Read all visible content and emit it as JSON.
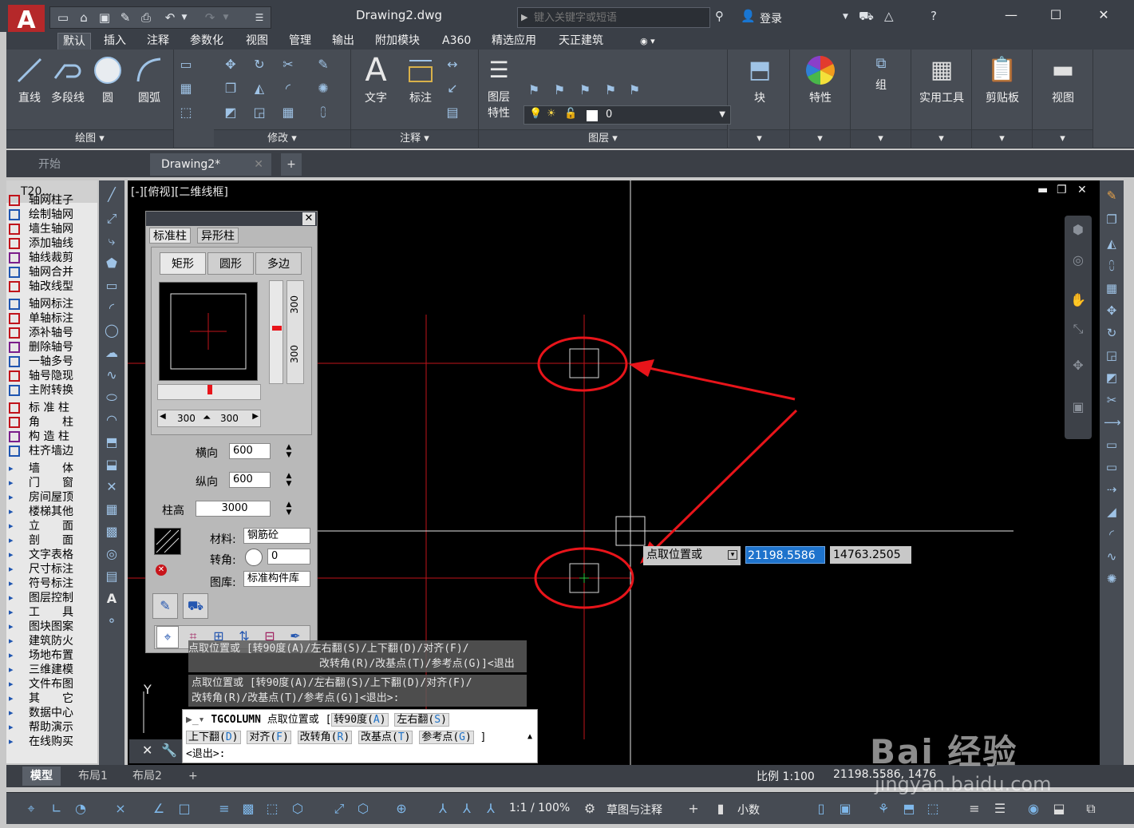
{
  "window": {
    "doc_title": "Drawing2.dwg",
    "search_placeholder": "键入关键字或短语",
    "login": "登录"
  },
  "menu_tabs": [
    "默认",
    "插入",
    "注释",
    "参数化",
    "视图",
    "管理",
    "输出",
    "附加模块",
    "A360",
    "精选应用",
    "天正建筑"
  ],
  "ribbon": {
    "draw": {
      "title": "绘图",
      "line": "直线",
      "polyline": "多段线",
      "circle": "圆",
      "arc": "圆弧"
    },
    "modify": {
      "title": "修改"
    },
    "annotation": {
      "title": "注释",
      "text": "文字",
      "dimension": "标注"
    },
    "layers": {
      "title": "图层",
      "props_line1": "图层",
      "props_line2": "特性",
      "current_layer": "0"
    },
    "block": "块",
    "properties": "特性",
    "group": "组",
    "utilities": "实用工具",
    "clipboard": "剪贴板",
    "view": "视图"
  },
  "file_tabs": {
    "start": "开始",
    "drawing": "Drawing2*"
  },
  "t20": {
    "title": "T20...",
    "items": [
      "轴网柱子",
      "绘制轴网",
      "墙生轴网",
      "添加轴线",
      "轴线裁剪",
      "轴网合并",
      "轴改线型",
      "轴网标注",
      "单轴标注",
      "添补轴号",
      "删除轴号",
      "一轴多号",
      "轴号隐现",
      "主附转换",
      "标 准 柱",
      "角　　柱",
      "构 造 柱",
      "柱齐墙边",
      "墙　　体",
      "门　　窗",
      "房间屋顶",
      "楼梯其他",
      "立　　面",
      "剖　　面",
      "文字表格",
      "尺寸标注",
      "符号标注",
      "图层控制",
      "工　　具",
      "图块图案",
      "建筑防火",
      "场地布置",
      "三维建模",
      "文件布图",
      "其　　它",
      "数据中心",
      "帮助演示",
      "在线购买"
    ]
  },
  "viewport": {
    "label": "[-][俯视][二维线框]"
  },
  "column_dialog": {
    "tab_standard": "标准柱",
    "tab_special": "异形柱",
    "shape_rect": "矩形",
    "shape_circle": "圆形",
    "shape_poly": "多边",
    "offset_x_left": "300",
    "offset_x_right": "300",
    "offset_y_top": "300",
    "offset_y_bottom": "300",
    "horizontal_label": "横向",
    "horizontal_value": "600",
    "vertical_label": "纵向",
    "vertical_value": "600",
    "height_label": "柱高",
    "height_value": "3000",
    "material_label": "材料:",
    "material_value": "钢筋砼",
    "angle_label": "转角:",
    "angle_value": "0",
    "library_label": "图库:",
    "library_value": "标准构件库"
  },
  "command": {
    "hist1_line1": "点取位置或 [转90度(A)/左右翻(S)/上下翻(D)/对齐(F)/",
    "hist1_line2": "改转角(R)/改基点(T)/参考点(G)]<退出>:",
    "hist2_line1": "点取位置或 [转90度(A)/左右翻(S)/上下翻(D)/对齐(F)/",
    "hist2_line2": "改转角(R)/改基点(T)/参考点(G)]<退出>:",
    "name": "TGCOLUMN",
    "prompt": "点取位置或 [",
    "opt_a_label": "转90度",
    "opt_a_key": "A",
    "opt_s_label": "左右翻",
    "opt_s_key": "S",
    "opt_d_label": "上下翻",
    "opt_d_key": "D",
    "opt_f_label": "对齐",
    "opt_f_key": "F",
    "opt_r_label": "改转角",
    "opt_r_key": "R",
    "opt_t_label": "改基点",
    "opt_t_key": "T",
    "opt_g_label": "参考点",
    "opt_g_key": "G",
    "close": "]",
    "exit": "<退出>:"
  },
  "dynamic_input": {
    "label": "点取位置或",
    "x": "21198.5586",
    "y": "14763.2505"
  },
  "layout_tabs": {
    "model": "模型",
    "layout1": "布局1",
    "layout2": "布局2"
  },
  "status": {
    "scale": "比例 1:100",
    "coords": "21198.5586, 14763.2505",
    "annotation_scale": "1:1 / 100%",
    "workspace": "草图与注释",
    "units": "小数"
  },
  "watermark": {
    "brand": "Bai 经验",
    "site": "jingyan.baidu.com"
  },
  "colors": {
    "accent": "#1e73cc",
    "highlight_red": "#e8141a",
    "canvas": "#000000"
  }
}
